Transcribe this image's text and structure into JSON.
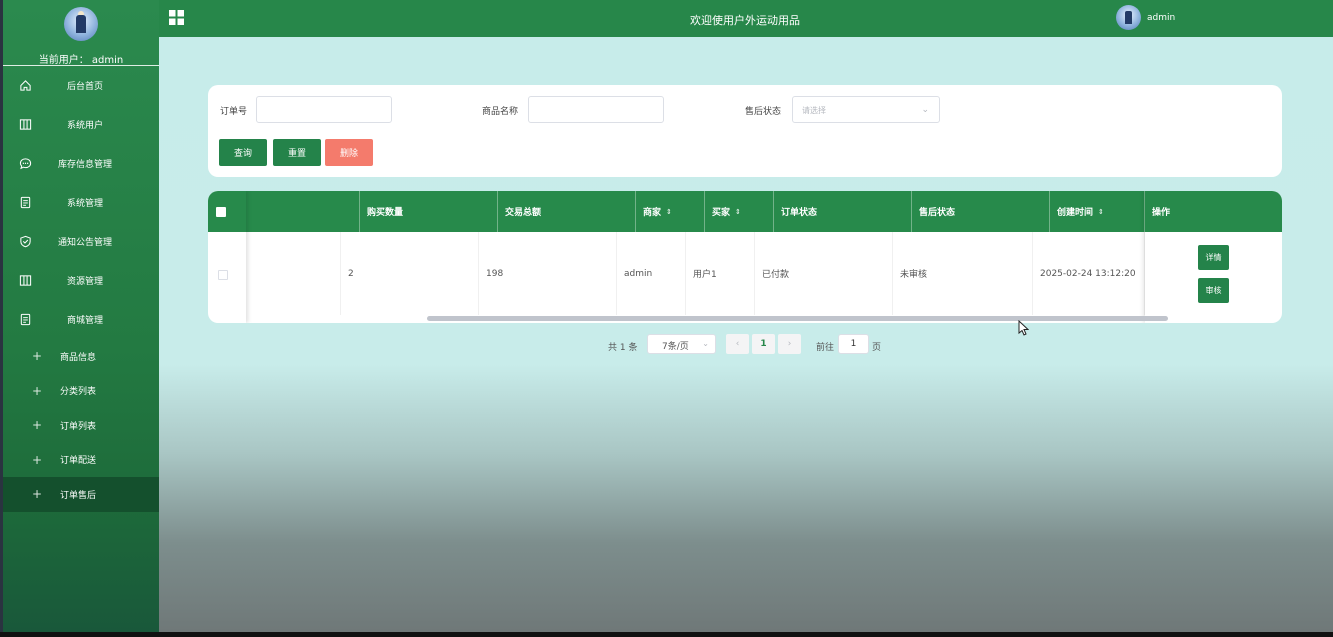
{
  "sidebar": {
    "current_user_label": "当前用户：",
    "current_user": "admin",
    "menu": [
      {
        "label": "后台首页",
        "icon": "home-icon"
      },
      {
        "label": "系统用户",
        "icon": "columns-icon"
      },
      {
        "label": "库存信息管理",
        "icon": "chat-icon"
      },
      {
        "label": "系统管理",
        "icon": "document-icon"
      },
      {
        "label": "通知公告管理",
        "icon": "shield-icon"
      },
      {
        "label": "资源管理",
        "icon": "columns-icon"
      },
      {
        "label": "商城管理",
        "icon": "document-icon"
      }
    ],
    "submenu": [
      {
        "label": "商品信息",
        "icon": "plus-icon",
        "active": false
      },
      {
        "label": "分类列表",
        "icon": "plus-icon",
        "active": false
      },
      {
        "label": "订单列表",
        "icon": "plus-icon",
        "active": false
      },
      {
        "label": "订单配送",
        "icon": "plus-icon",
        "active": false
      },
      {
        "label": "订单售后",
        "icon": "plus-icon",
        "active": true
      }
    ]
  },
  "header": {
    "title": "欢迎使用户外运动用品",
    "user": "admin"
  },
  "search": {
    "order_no_label": "订单号",
    "order_no_value": "",
    "product_name_label": "商品名称",
    "product_name_value": "",
    "after_sale_status_label": "售后状态",
    "after_sale_status_placeholder": "请选择",
    "query_button": "查询",
    "reset_button": "重置",
    "delete_button": "删除"
  },
  "table": {
    "columns": [
      {
        "label": "",
        "sortable": false
      },
      {
        "label": "购买数量",
        "sortable": false
      },
      {
        "label": "交易总额",
        "sortable": false
      },
      {
        "label": "商家",
        "sortable": true
      },
      {
        "label": "买家",
        "sortable": true
      },
      {
        "label": "订单状态",
        "sortable": false
      },
      {
        "label": "售后状态",
        "sortable": false
      },
      {
        "label": "创建时间",
        "sortable": true
      },
      {
        "label": "操作",
        "sortable": false
      }
    ],
    "rows": [
      {
        "quantity": "2",
        "total": "198",
        "merchant": "admin",
        "buyer": "用户1",
        "order_status": "已付款",
        "after_sale_status": "未审核",
        "created_at": "2025-02-24 13:12:20",
        "actions": [
          "详情",
          "审核"
        ]
      }
    ]
  },
  "pagination": {
    "total_text": "共 1 条",
    "page_size": "7条/页",
    "current_page": "1",
    "goto_label": "前往",
    "goto_value": "1",
    "page_suffix": "页"
  }
}
